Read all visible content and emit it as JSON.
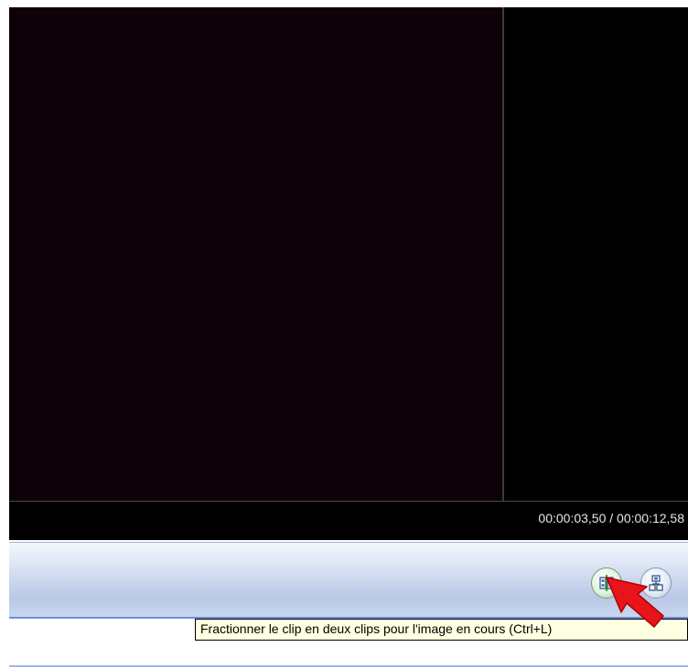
{
  "player": {
    "time_display": "00:00:03,50 / 00:00:12,58"
  },
  "controls": {
    "split_icon": "split-clip-icon",
    "combine_icon": "combine-clips-icon"
  },
  "tooltip": {
    "text": "Fractionner le clip en deux clips pour l'image en cours (Ctrl+L)"
  },
  "colors": {
    "preview_bg": "#0e0108",
    "tooltip_bg": "#ffffe1",
    "cursor": "#e8141c",
    "accent": "#6d8fd4"
  }
}
